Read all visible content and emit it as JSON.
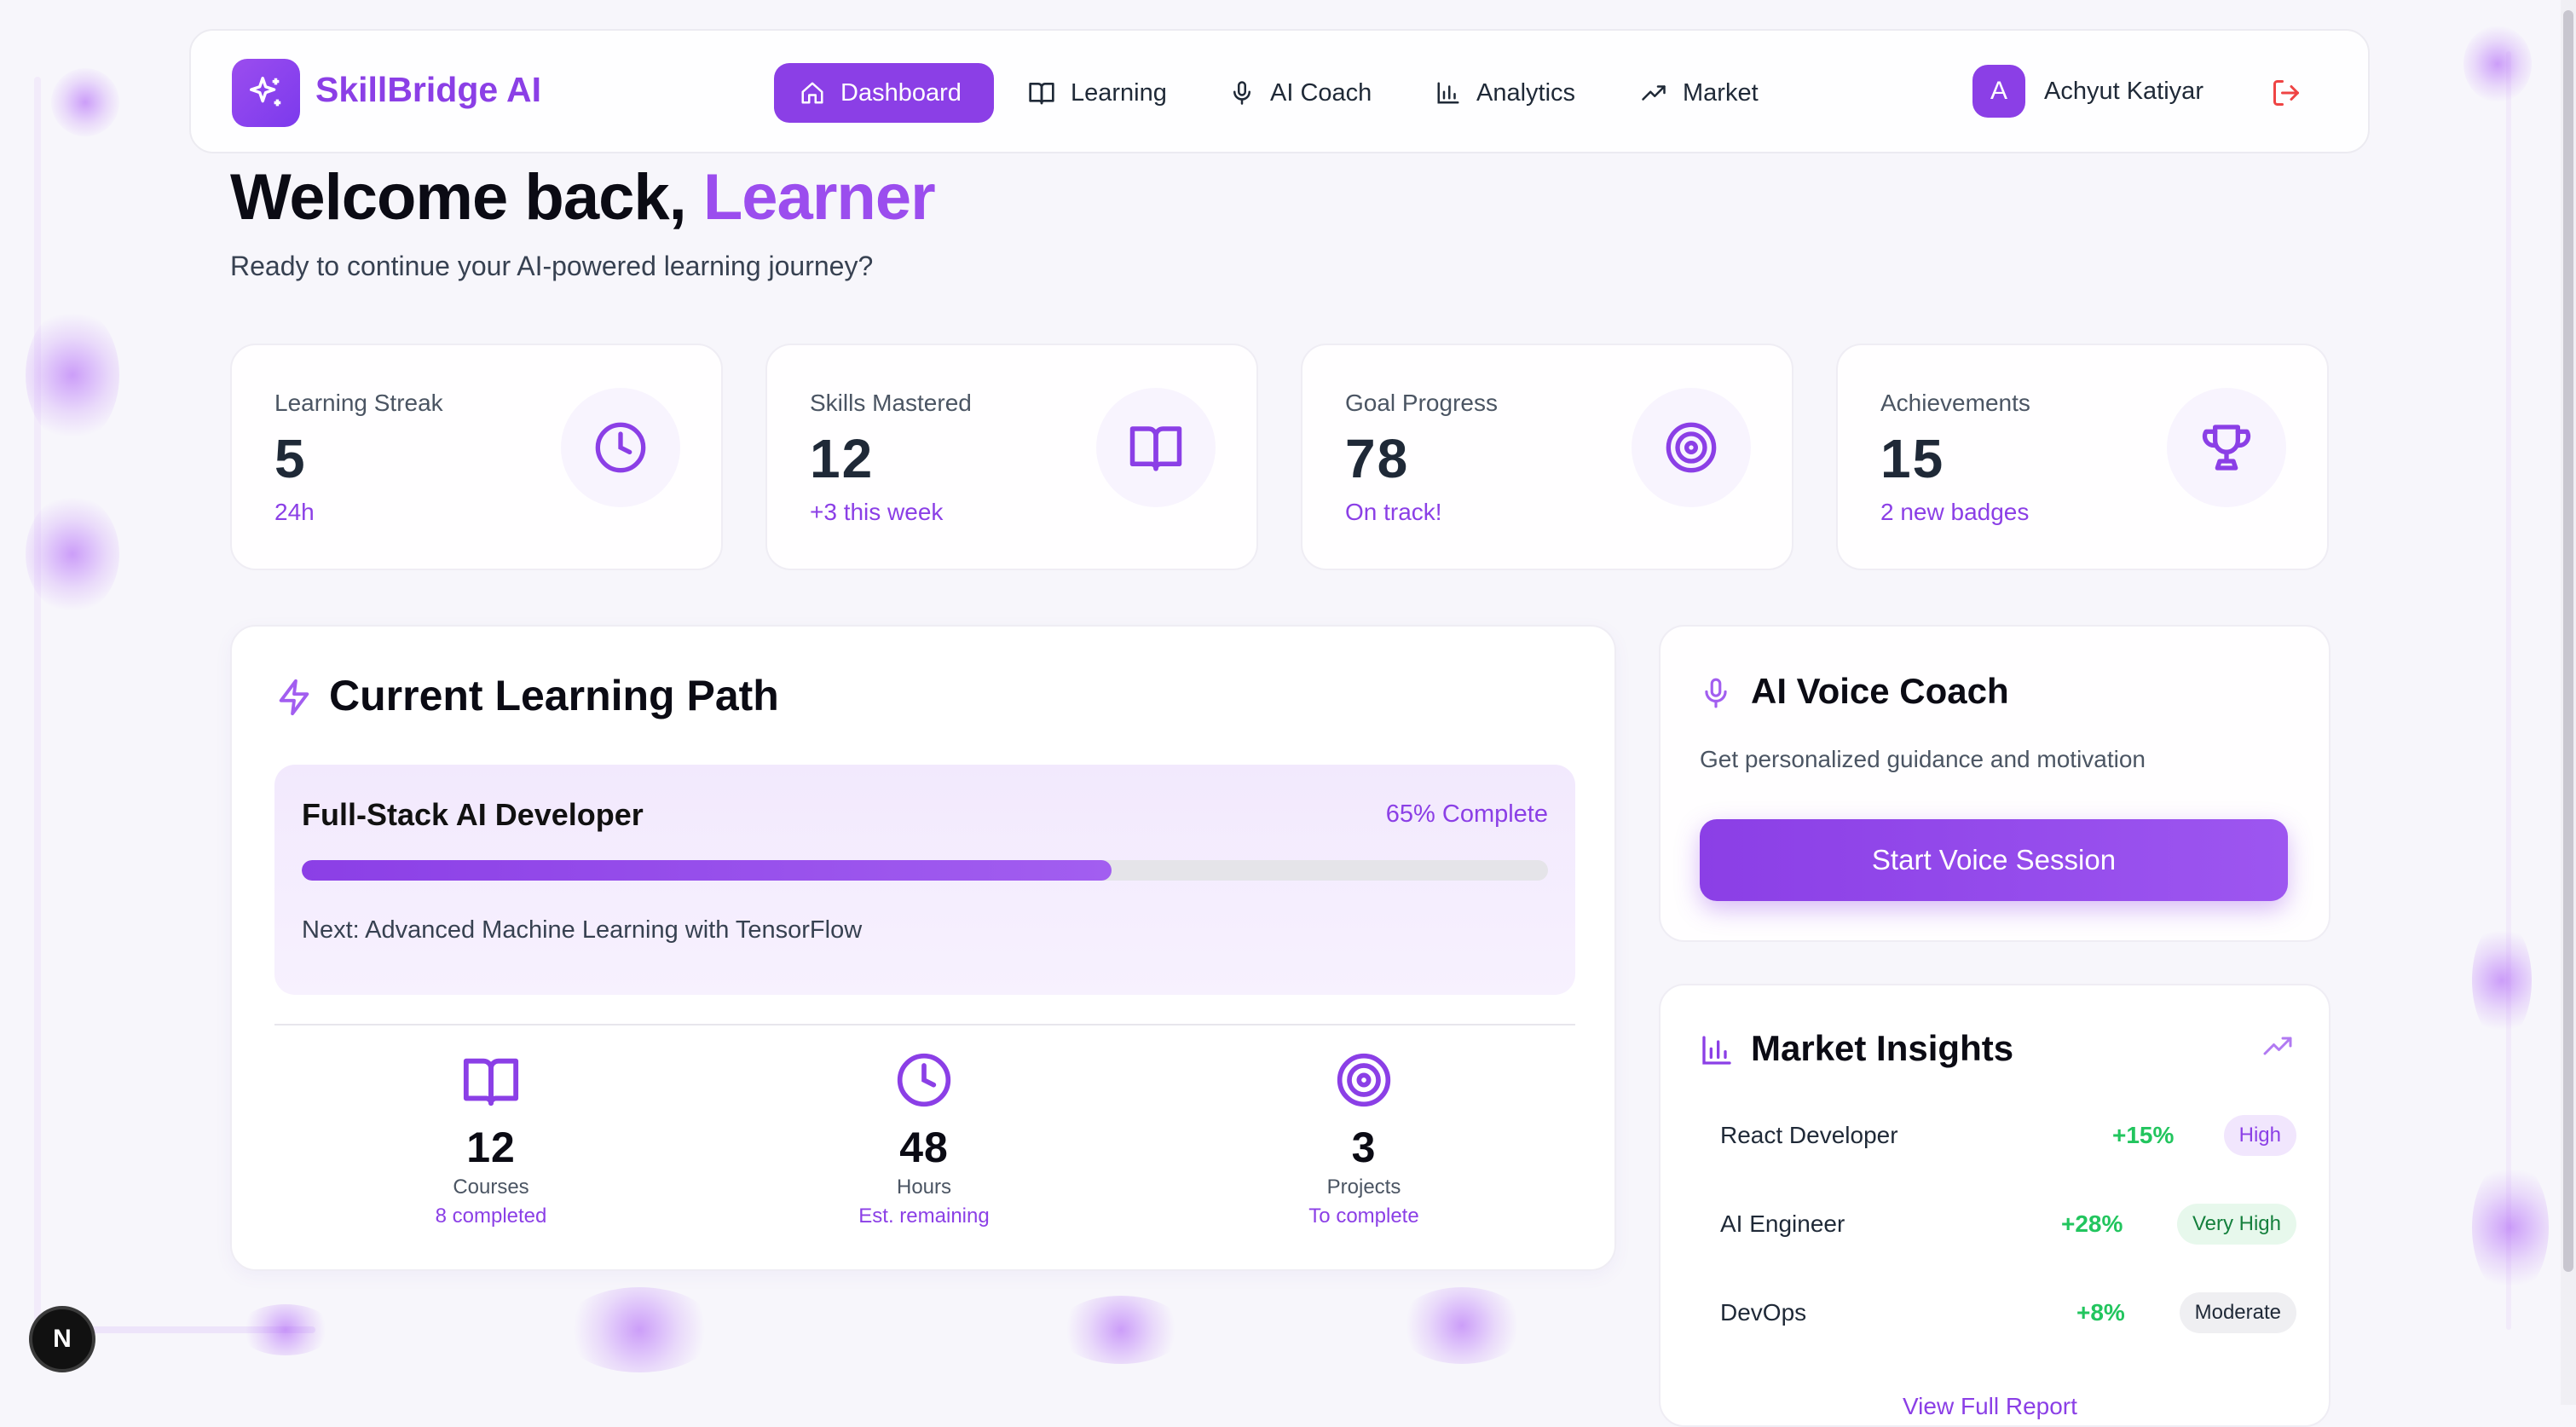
{
  "brand": {
    "name": "SkillBridge AI",
    "icon": "sparkles-icon",
    "color": "#8b3fe6"
  },
  "nav": {
    "items": [
      {
        "label": "Dashboard",
        "icon": "home-icon",
        "active": true
      },
      {
        "label": "Learning",
        "icon": "book-icon",
        "active": false
      },
      {
        "label": "AI Coach",
        "icon": "mic-icon",
        "active": false
      },
      {
        "label": "Analytics",
        "icon": "bar-chart-icon",
        "active": false
      },
      {
        "label": "Market",
        "icon": "trending-up-icon",
        "active": false
      }
    ],
    "user": {
      "initial": "A",
      "name": "Achyut Katiyar"
    },
    "logout_icon": "logout-icon"
  },
  "welcome": {
    "title_prefix": "Welcome back,",
    "title_name": "Learner",
    "subtitle": "Ready to continue your AI-powered learning journey?"
  },
  "stats": [
    {
      "label": "Learning Streak",
      "value": "5",
      "sub": "24h",
      "icon": "clock-icon"
    },
    {
      "label": "Skills Mastered",
      "value": "12",
      "sub": "+3 this week",
      "icon": "book-icon"
    },
    {
      "label": "Goal Progress",
      "value": "78",
      "sub": "On track!",
      "icon": "target-icon"
    },
    {
      "label": "Achievements",
      "value": "15",
      "sub": "2 new badges",
      "icon": "trophy-icon"
    }
  ],
  "learning_path": {
    "title": "Current Learning Path",
    "path_name": "Full-Stack AI Developer",
    "percent_label": "65% Complete",
    "progress": 0.65,
    "next": "Next: Advanced Machine Learning with TensorFlow",
    "mini_stats": [
      {
        "value": "12",
        "label": "Courses",
        "sub": "8 completed",
        "icon": "book-icon"
      },
      {
        "value": "48",
        "label": "Hours",
        "sub": "Est. remaining",
        "icon": "clock-icon"
      },
      {
        "value": "3",
        "label": "Projects",
        "sub": "To complete",
        "icon": "target-icon"
      }
    ]
  },
  "voice_coach": {
    "title": "AI Voice Coach",
    "subtitle": "Get personalized guidance and motivation",
    "button": "Start Voice Session"
  },
  "market": {
    "title": "Market Insights",
    "rows": [
      {
        "role": "React Developer",
        "growth": "+15%",
        "demand": "High",
        "badge_bg": "#f1e6fd",
        "badge_fg": "#8b3fe6"
      },
      {
        "role": "AI Engineer",
        "growth": "+28%",
        "demand": "Very High",
        "badge_bg": "#e7f8ec",
        "badge_fg": "#15803d"
      },
      {
        "role": "DevOps",
        "growth": "+8%",
        "demand": "Moderate",
        "badge_bg": "#efeff2",
        "badge_fg": "#1f2937"
      }
    ],
    "link": "View Full Report"
  },
  "framework_badge": "N"
}
